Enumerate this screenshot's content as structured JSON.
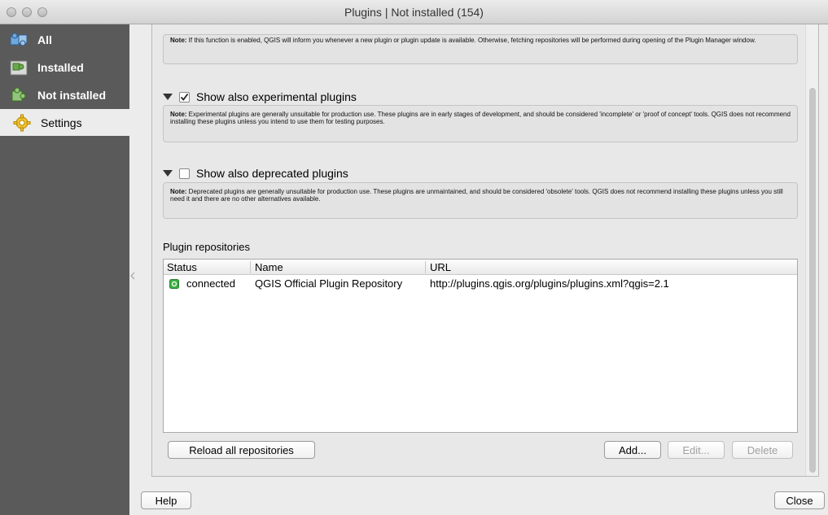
{
  "window": {
    "title": "Plugins | Not installed (154)"
  },
  "sidebar": {
    "items": [
      {
        "label": "All",
        "icon": "puzzle-blue-icon"
      },
      {
        "label": "Installed",
        "icon": "puzzle-box-icon"
      },
      {
        "label": "Not installed",
        "icon": "puzzle-green-icon"
      },
      {
        "label": "Settings",
        "icon": "gear-icon"
      }
    ]
  },
  "settings": {
    "check_updates_note": {
      "bold": "Note:",
      "text": " If this function is enabled, QGIS will inform you whenever a new plugin or plugin update is available. Otherwise, fetching repositories will be performed during opening of the Plugin Manager window."
    },
    "experimental": {
      "label": "Show also experimental plugins",
      "checked": true,
      "note": {
        "bold": "Note:",
        "text": " Experimental plugins are generally unsuitable for production use. These plugins are in early stages of development, and should be considered 'incomplete' or 'proof of concept' tools. QGIS does not recommend installing these plugins unless you intend to use them for testing purposes."
      }
    },
    "deprecated": {
      "label": "Show also deprecated plugins",
      "checked": false,
      "note": {
        "bold": "Note:",
        "text": " Deprecated plugins are generally unsuitable for production use. These plugins are unmaintained, and should be considered 'obsolete' tools. QGIS does not recommend installing these plugins unless you still need it and there are no other alternatives available."
      }
    }
  },
  "repositories": {
    "section_label": "Plugin repositories",
    "columns": [
      "Status",
      "Name",
      "URL"
    ],
    "rows": [
      {
        "status": "connected",
        "name": "QGIS Official Plugin Repository",
        "url": "http://plugins.qgis.org/plugins/plugins.xml?qgis=2.1"
      }
    ],
    "buttons": {
      "reload": "Reload all repositories",
      "add": "Add...",
      "edit": "Edit...",
      "delete": "Delete"
    }
  },
  "footer": {
    "help": "Help",
    "close": "Close"
  },
  "colors": {
    "sidebar_bg": "#5a5a5a",
    "status_connected": "#3cb043"
  }
}
